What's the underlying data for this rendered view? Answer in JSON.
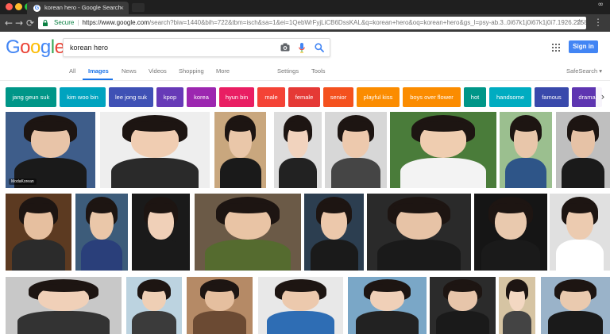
{
  "browser": {
    "tab_title": "korean hero - Google Search",
    "close_glyph": "×",
    "profile_glyph": "∞",
    "secure_label": "Secure",
    "url_host": "https://www.google.com",
    "url_rest": "/search?biw=1440&bih=722&tbm=isch&sa=1&ei=1QebWrFyjLiCB6DssKAL&q=korean+hero&oq=korean+hero&gs_l=psy-ab.3..0i67k1j0i67k1j0i7.1926.2258.0....",
    "traffic_colors": [
      "#ff5f57",
      "#febc2e",
      "#28c840"
    ],
    "back_glyph": "←",
    "forward_glyph": "→",
    "reload_glyph": "⟳",
    "star_glyph": "☆",
    "menu_glyph": "⋮"
  },
  "google": {
    "logo_letters": [
      {
        "ch": "G",
        "color": "#4285f4"
      },
      {
        "ch": "o",
        "color": "#ea4335"
      },
      {
        "ch": "o",
        "color": "#fbbc05"
      },
      {
        "ch": "g",
        "color": "#4285f4"
      },
      {
        "ch": "l",
        "color": "#34a853"
      },
      {
        "ch": "e",
        "color": "#ea4335"
      }
    ],
    "query": "korean hero",
    "sign_in": "Sign in",
    "accent": "#4285f4"
  },
  "tabs": [
    {
      "label": "All",
      "active": false
    },
    {
      "label": "Images",
      "active": true
    },
    {
      "label": "News",
      "active": false
    },
    {
      "label": "Videos",
      "active": false
    },
    {
      "label": "Shopping",
      "active": false
    },
    {
      "label": "More",
      "active": false
    },
    {
      "label": "Settings",
      "active": false
    },
    {
      "label": "Tools",
      "active": false
    },
    {
      "label": "SafeSearch ▾",
      "active": false
    }
  ],
  "chips": [
    {
      "label": "jang geun suk",
      "color": "#009688"
    },
    {
      "label": "kim woo bin",
      "color": "#00a3bf"
    },
    {
      "label": "lee jong suk",
      "color": "#3f51b5"
    },
    {
      "label": "kpop",
      "color": "#673ab7"
    },
    {
      "label": "korea",
      "color": "#9c27b0"
    },
    {
      "label": "hyun bin",
      "color": "#e91e63"
    },
    {
      "label": "male",
      "color": "#f44336"
    },
    {
      "label": "female",
      "color": "#e53935"
    },
    {
      "label": "senior",
      "color": "#f4511e"
    },
    {
      "label": "playful kiss",
      "color": "#fb8c00"
    },
    {
      "label": "boys over flower",
      "color": "#fb8c00"
    },
    {
      "label": "hot",
      "color": "#009688"
    },
    {
      "label": "handsome",
      "color": "#00acc1"
    },
    {
      "label": "famous",
      "color": "#3949ab"
    },
    {
      "label": "drama",
      "color": "#5e35b1"
    }
  ],
  "chip_arrow_glyph": "›",
  "image_rows": [
    [
      {
        "bg": "#3e5d8a",
        "skin": "#e8c4a8",
        "body": "#1a1a1a",
        "watermark": "ModaKorean"
      },
      {
        "bg": "#eeeeee",
        "skin": "#f0cdb2",
        "body": "#2a2a2a"
      },
      {
        "bg": "#c9a77e",
        "skin": "#eac7a9",
        "body": "#1a1a1a"
      },
      {
        "bg": "#dddddd",
        "skin": "#f1d3be",
        "body": "#222222"
      },
      {
        "bg": "#d7d7d7",
        "skin": "#edc9ad",
        "body": "#454545"
      },
      {
        "bg": "#4a7c3a",
        "skin": "#efcdb0",
        "body": "#f3f3f3"
      },
      {
        "bg": "#9bbf8f",
        "skin": "#e8c6aa",
        "body": "#2e5588"
      },
      {
        "bg": "#bfbfbf",
        "skin": "#e6c2a6",
        "body": "#1a1a1a"
      }
    ],
    [
      {
        "bg": "#5c3a21",
        "skin": "#e6bf9f",
        "body": "#2b2b2b"
      },
      {
        "bg": "#3d5c7a",
        "skin": "#eac7a9",
        "body": "#2a3f7a"
      },
      {
        "bg": "#1a1a1a",
        "skin": "#f0d0b8",
        "body": "#1a1a1a"
      },
      {
        "bg": "#6b5a47",
        "skin": "#e9c4a5",
        "body": "#556b2f"
      },
      {
        "bg": "#2c3e50",
        "skin": "#ecc8ab",
        "body": "#1a1a1a"
      },
      {
        "bg": "#2a2a2a",
        "skin": "#e7c3a6",
        "body": "#1a1a1a"
      },
      {
        "bg": "#151515",
        "skin": "#e9c9ae",
        "body": "#1a1a1a"
      },
      {
        "bg": "#e0e0e0",
        "skin": "#eccbb0",
        "body": "#ffffff"
      }
    ],
    [
      {
        "bg": "#c8c8c8",
        "skin": "#f0d0b8",
        "body": "#333333"
      },
      {
        "bg": "#bcd3e0",
        "skin": "#efcfb5",
        "body": "#3b3b3b"
      },
      {
        "bg": "#b58a66",
        "skin": "#e5bf9f",
        "body": "#6b4a33"
      },
      {
        "bg": "#e8e8e8",
        "skin": "#ecc9ad",
        "body": "#2e6db4"
      },
      {
        "bg": "#7aa7c7",
        "skin": "#f0d0b8",
        "body": "#222222"
      },
      {
        "bg": "#2b2b2b",
        "skin": "#e7c5aa",
        "body": "#1a1a1a"
      },
      {
        "bg": "#d6c4a3",
        "skin": "#f3d8c2",
        "body": "#444444"
      },
      {
        "bg": "#9ab3c9",
        "skin": "#eacaaf",
        "body": "#1a1a1a"
      }
    ]
  ]
}
